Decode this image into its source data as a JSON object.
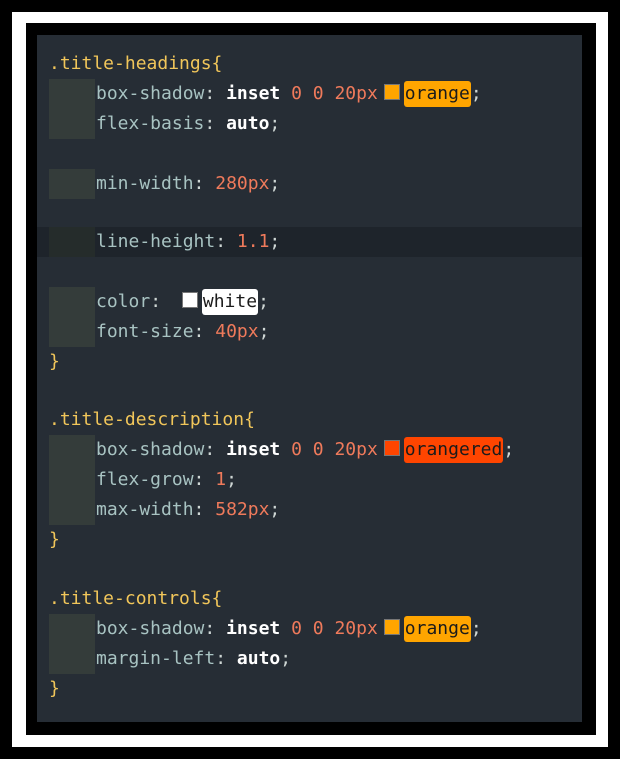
{
  "colors": {
    "background": "#262d35",
    "selector": "#f1c65a",
    "property": "#a8c3c2",
    "number": "#ef7a5b",
    "orange": "#ffa500",
    "orangered": "#ff4500",
    "white": "#ffffff"
  },
  "rules": [
    {
      "selector": ".title-headings{",
      "declarations": [
        {
          "prop": "box-shadow",
          "value_kw": "inset",
          "value_nums": "0 0 20px",
          "color_name": "orange",
          "color": "#ffa500"
        },
        {
          "prop": "flex-basis",
          "value_kw": "auto"
        },
        {
          "prop": "min-width",
          "value_num": "280px"
        },
        {
          "prop": "line-height",
          "value_num": "1.1"
        },
        {
          "prop": "color",
          "color_name": "white",
          "color": "#ffffff"
        },
        {
          "prop": "font-size",
          "value_num": "40px"
        }
      ],
      "close": "}"
    },
    {
      "selector": ".title-description{",
      "declarations": [
        {
          "prop": "box-shadow",
          "value_kw": "inset",
          "value_nums": "0 0 20px",
          "color_name": "orangered",
          "color": "#ff4500"
        },
        {
          "prop": "flex-grow",
          "value_num": "1"
        },
        {
          "prop": "max-width",
          "value_num": "582px"
        }
      ],
      "close": "}"
    },
    {
      "selector": ".title-controls{",
      "declarations": [
        {
          "prop": "box-shadow",
          "value_kw": "inset",
          "value_nums": "0 0 20px",
          "color_name": "orange",
          "color": "#ffa500"
        },
        {
          "prop": "margin-left",
          "value_kw": "auto"
        }
      ],
      "close": "}"
    }
  ]
}
